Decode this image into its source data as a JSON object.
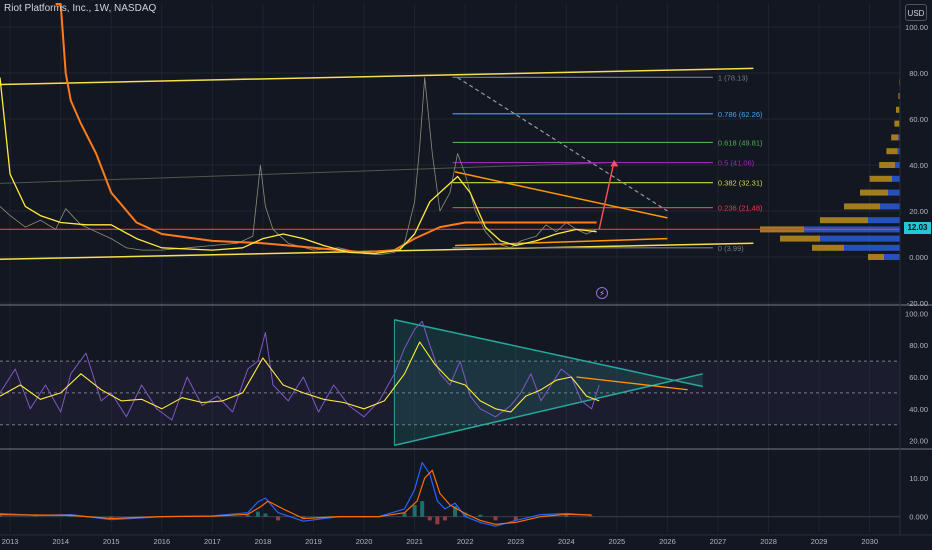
{
  "header": {
    "symbol": "Riot Platforms, Inc., 1W, NASDAQ",
    "currency_button": "USD"
  },
  "price_label": "12.03",
  "colors": {
    "background": "#131722",
    "grid": "#1f2430",
    "price": "#8c8c7a",
    "sma_short": "#ffeb3b",
    "sma_long": "#ff7a1a",
    "channel": "#f5e04a",
    "rsi_line": "#7e57c2",
    "rsi_ma": "#ffeb3b",
    "macd": "#2962ff",
    "signal": "#ff6d00",
    "triangle": "#26a69a",
    "current_price": "#f23645"
  },
  "chart_data": [
    {
      "type": "line",
      "panel": "price",
      "y_ticks": [
        "100.00",
        "80.00",
        "60.00",
        "40.00",
        "20.00",
        "0.000",
        "-20.00"
      ],
      "ylim": [
        -20,
        110
      ],
      "x_ticks": [
        "2013",
        "2014",
        "2015",
        "2016",
        "2017",
        "2018",
        "2019",
        "2020",
        "2021",
        "2022",
        "2023",
        "2024",
        "2025",
        "2026",
        "2027",
        "2028",
        "2029",
        "2030"
      ],
      "xlim": [
        2012.8,
        2030.6
      ],
      "current_price": 12.03,
      "series": [
        {
          "key": "price",
          "x": [
            2012.8,
            2013.0,
            2013.3,
            2013.6,
            2013.9,
            2014.1,
            2014.4,
            2014.7,
            2015.0,
            2015.3,
            2015.6,
            2016.0,
            2016.5,
            2017.0,
            2017.5,
            2017.8,
            2017.95,
            2018.05,
            2018.2,
            2018.5,
            2019.0,
            2019.5,
            2020.0,
            2020.3,
            2020.6,
            2020.8,
            2021.0,
            2021.1,
            2021.2,
            2021.35,
            2021.5,
            2021.7,
            2021.85,
            2022.0,
            2022.2,
            2022.4,
            2022.6,
            2022.9,
            2023.1,
            2023.4,
            2023.6,
            2023.8,
            2024.0,
            2024.2,
            2024.4,
            2024.6
          ],
          "y": [
            22,
            18,
            13,
            16,
            12,
            21,
            14,
            11,
            8,
            4,
            3,
            3,
            4,
            5,
            6,
            9,
            40,
            22,
            12,
            6,
            3,
            4,
            1.5,
            1,
            2,
            6,
            24,
            48,
            78,
            45,
            20,
            28,
            45,
            36,
            20,
            11,
            6,
            4,
            7,
            9,
            14,
            11,
            15,
            12,
            10,
            12
          ]
        },
        {
          "key": "sma_short",
          "x": [
            2012.8,
            2013.0,
            2013.3,
            2013.6,
            2014.0,
            2014.5,
            2015.0,
            2015.5,
            2016.0,
            2017.0,
            2017.6,
            2018.0,
            2018.4,
            2018.8,
            2019.2,
            2019.7,
            2020.2,
            2020.7,
            2021.0,
            2021.3,
            2021.6,
            2021.85,
            2022.1,
            2022.4,
            2022.7,
            2023.0,
            2023.4,
            2023.8,
            2024.2,
            2024.6
          ],
          "y": [
            78,
            36,
            22,
            18,
            15,
            14,
            14,
            8,
            4,
            3,
            4,
            8,
            10,
            8,
            5,
            2,
            1.5,
            3,
            10,
            24,
            30,
            35,
            28,
            13,
            7,
            5,
            7,
            10,
            12,
            11
          ]
        },
        {
          "key": "sma_long",
          "x": [
            2013.9,
            2014.0,
            2014.1,
            2014.2,
            2014.4,
            2014.7,
            2015.0,
            2015.5,
            2016.0,
            2017.0,
            2018.0,
            2019.0,
            2020.0,
            2020.6,
            2021.0,
            2021.5,
            2022.0,
            2023.0,
            2024.0,
            2024.6
          ],
          "y": [
            135,
            110,
            80,
            68,
            58,
            45,
            28,
            15,
            10,
            7,
            6,
            4,
            2,
            3,
            8,
            13,
            15,
            15,
            15,
            15
          ]
        }
      ],
      "fibonacci": [
        {
          "level": "1",
          "value": 78.13,
          "label": "1 (78.13)"
        },
        {
          "level": "0.786",
          "value": 62.26,
          "label": "0.786 (62.26)"
        },
        {
          "level": "0.618",
          "value": 49.81,
          "label": "0.618 (49.81)"
        },
        {
          "level": "0.5",
          "value": 41.06,
          "label": "0.5 (41.06)"
        },
        {
          "level": "0.382",
          "value": 32.31,
          "label": "0.382 (32.31)"
        },
        {
          "level": "0.236",
          "value": 21.48,
          "label": "0.236 (21.48)"
        },
        {
          "level": "0",
          "value": 3.99,
          "label": "0 (3.99)"
        }
      ],
      "volume_profile": [
        {
          "price": 76,
          "up": 1,
          "down": 0
        },
        {
          "price": 70,
          "up": 2,
          "down": 0
        },
        {
          "price": 64,
          "up": 4,
          "down": 1
        },
        {
          "price": 58,
          "up": 6,
          "down": 1
        },
        {
          "price": 52,
          "up": 9,
          "down": 2
        },
        {
          "price": 46,
          "up": 14,
          "down": 3
        },
        {
          "price": 40,
          "up": 20,
          "down": 6
        },
        {
          "price": 34,
          "up": 28,
          "down": 10
        },
        {
          "price": 28,
          "up": 35,
          "down": 15
        },
        {
          "price": 22,
          "up": 45,
          "down": 25
        },
        {
          "price": 16,
          "up": 60,
          "down": 40
        },
        {
          "price": 12,
          "up": 55,
          "down": 120
        },
        {
          "price": 8,
          "up": 50,
          "down": 100
        },
        {
          "price": 4,
          "up": 40,
          "down": 70
        },
        {
          "price": 0,
          "up": 20,
          "down": 20
        }
      ]
    },
    {
      "type": "line",
      "panel": "rsi",
      "y_ticks": [
        "100.00",
        "80.00",
        "60.00",
        "40.00",
        "20.00"
      ],
      "ylim": [
        16,
        104
      ],
      "bands": [
        70,
        50,
        30
      ],
      "series": [
        {
          "key": "rsi_line",
          "x": [
            2012.8,
            2013.1,
            2013.4,
            2013.7,
            2014.0,
            2014.2,
            2014.5,
            2014.8,
            2015.0,
            2015.3,
            2015.6,
            2015.9,
            2016.2,
            2016.5,
            2016.8,
            2017.1,
            2017.4,
            2017.7,
            2017.9,
            2018.05,
            2018.2,
            2018.5,
            2018.8,
            2019.1,
            2019.4,
            2019.7,
            2020.0,
            2020.3,
            2020.6,
            2020.8,
            2021.0,
            2021.15,
            2021.3,
            2021.5,
            2021.7,
            2021.9,
            2022.1,
            2022.3,
            2022.6,
            2022.9,
            2023.1,
            2023.3,
            2023.5,
            2023.7,
            2023.9,
            2024.1,
            2024.3,
            2024.5,
            2024.65
          ],
          "y": [
            50,
            65,
            40,
            55,
            38,
            62,
            75,
            45,
            50,
            35,
            55,
            40,
            33,
            60,
            42,
            48,
            38,
            65,
            70,
            88,
            55,
            45,
            60,
            38,
            55,
            42,
            35,
            45,
            62,
            78,
            90,
            95,
            80,
            62,
            55,
            70,
            48,
            40,
            35,
            42,
            50,
            62,
            45,
            55,
            65,
            60,
            45,
            40,
            55
          ]
        },
        {
          "key": "rsi_ma",
          "x": [
            2012.8,
            2013.2,
            2013.6,
            2014.0,
            2014.4,
            2014.8,
            2015.2,
            2015.6,
            2016.0,
            2016.4,
            2016.8,
            2017.2,
            2017.6,
            2018.0,
            2018.4,
            2018.8,
            2019.2,
            2019.6,
            2020.0,
            2020.4,
            2020.8,
            2021.1,
            2021.4,
            2021.7,
            2022.0,
            2022.3,
            2022.6,
            2022.9,
            2023.2,
            2023.5,
            2023.8,
            2024.1,
            2024.4,
            2024.65
          ],
          "y": [
            48,
            55,
            46,
            50,
            62,
            52,
            45,
            46,
            40,
            47,
            44,
            45,
            50,
            72,
            55,
            50,
            46,
            44,
            40,
            45,
            62,
            82,
            68,
            58,
            55,
            45,
            40,
            38,
            48,
            52,
            58,
            60,
            48,
            45
          ]
        }
      ]
    },
    {
      "type": "line",
      "panel": "macd",
      "y_ticks": [
        "10.00",
        "0.000"
      ],
      "ylim": [
        -4,
        17
      ],
      "series": [
        {
          "key": "macd",
          "x": [
            2012.8,
            2013.5,
            2014.2,
            2015.0,
            2016.0,
            2017.0,
            2017.7,
            2017.9,
            2018.05,
            2018.3,
            2018.8,
            2019.5,
            2020.3,
            2020.8,
            2021.0,
            2021.15,
            2021.3,
            2021.45,
            2021.6,
            2021.8,
            2022.0,
            2022.3,
            2022.6,
            2023.0,
            2023.5,
            2024.0,
            2024.5
          ],
          "y": [
            0.8,
            0.3,
            0.5,
            -0.8,
            0,
            0.2,
            1,
            3.8,
            4.8,
            1,
            -1.2,
            0,
            0,
            2,
            7,
            14,
            11,
            4,
            2,
            3.5,
            0,
            -1.5,
            -2.5,
            -1,
            0.5,
            0.8,
            0.3
          ]
        },
        {
          "key": "signal",
          "x": [
            2012.8,
            2013.5,
            2014.2,
            2015.0,
            2016.0,
            2017.0,
            2017.7,
            2017.95,
            2018.1,
            2018.4,
            2018.8,
            2019.5,
            2020.3,
            2020.8,
            2021.05,
            2021.2,
            2021.35,
            2021.5,
            2021.7,
            2022.0,
            2022.3,
            2022.6,
            2023.0,
            2023.5,
            2024.0,
            2024.5
          ],
          "y": [
            0.5,
            0.4,
            0.3,
            -0.5,
            0,
            0.1,
            0.6,
            2.5,
            4,
            2,
            -0.5,
            0,
            0,
            1,
            4,
            10,
            12,
            6,
            3,
            0.8,
            -1,
            -2,
            -1.5,
            0,
            0.6,
            0.4
          ]
        }
      ]
    }
  ]
}
